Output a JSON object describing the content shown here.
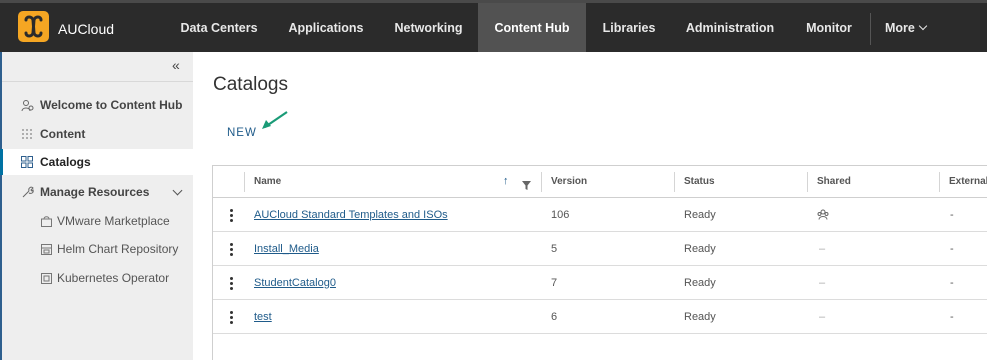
{
  "header": {
    "brand": "AUCloud",
    "nav": [
      {
        "label": "Data Centers"
      },
      {
        "label": "Applications"
      },
      {
        "label": "Networking"
      },
      {
        "label": "Content Hub",
        "active": true
      },
      {
        "label": "Libraries"
      },
      {
        "label": "Administration"
      },
      {
        "label": "Monitor"
      }
    ],
    "more_label": "More"
  },
  "sidebar": {
    "items": [
      {
        "label": "Welcome to Content Hub",
        "icon": "welcome-icon"
      },
      {
        "label": "Content",
        "icon": "content-grid-icon"
      },
      {
        "label": "Catalogs",
        "icon": "catalogs-icon",
        "active": true
      },
      {
        "label": "Manage Resources",
        "icon": "wrench-icon",
        "expanded": true
      }
    ],
    "subitems": [
      {
        "label": "VMware Marketplace",
        "icon": "marketplace-icon"
      },
      {
        "label": "Helm Chart Repository",
        "icon": "helm-icon"
      },
      {
        "label": "Kubernetes Operator",
        "icon": "operator-icon"
      }
    ]
  },
  "main": {
    "title": "Catalogs",
    "new_label": "NEW"
  },
  "table": {
    "columns": [
      "Name",
      "Version",
      "Status",
      "Shared",
      "External"
    ],
    "rows": [
      {
        "name": "AUCloud Standard Templates and ISOs",
        "version": "106",
        "status": "Ready",
        "shared": "shared-icon",
        "external": "-"
      },
      {
        "name": "Install_Media",
        "version": "5",
        "status": "Ready",
        "shared": "–",
        "external": "-"
      },
      {
        "name": "StudentCatalog0",
        "version": "7",
        "status": "Ready",
        "shared": "–",
        "external": "-"
      },
      {
        "name": "test",
        "version": "6",
        "status": "Ready",
        "shared": "–",
        "external": "-"
      }
    ]
  },
  "colors": {
    "header_bg": "#2b2b2b",
    "nav_active_bg": "#525252",
    "link": "#1f5b8a",
    "accent": "#0072a3",
    "brand_logo": "#f5a623",
    "arrow": "#1a9b77"
  }
}
